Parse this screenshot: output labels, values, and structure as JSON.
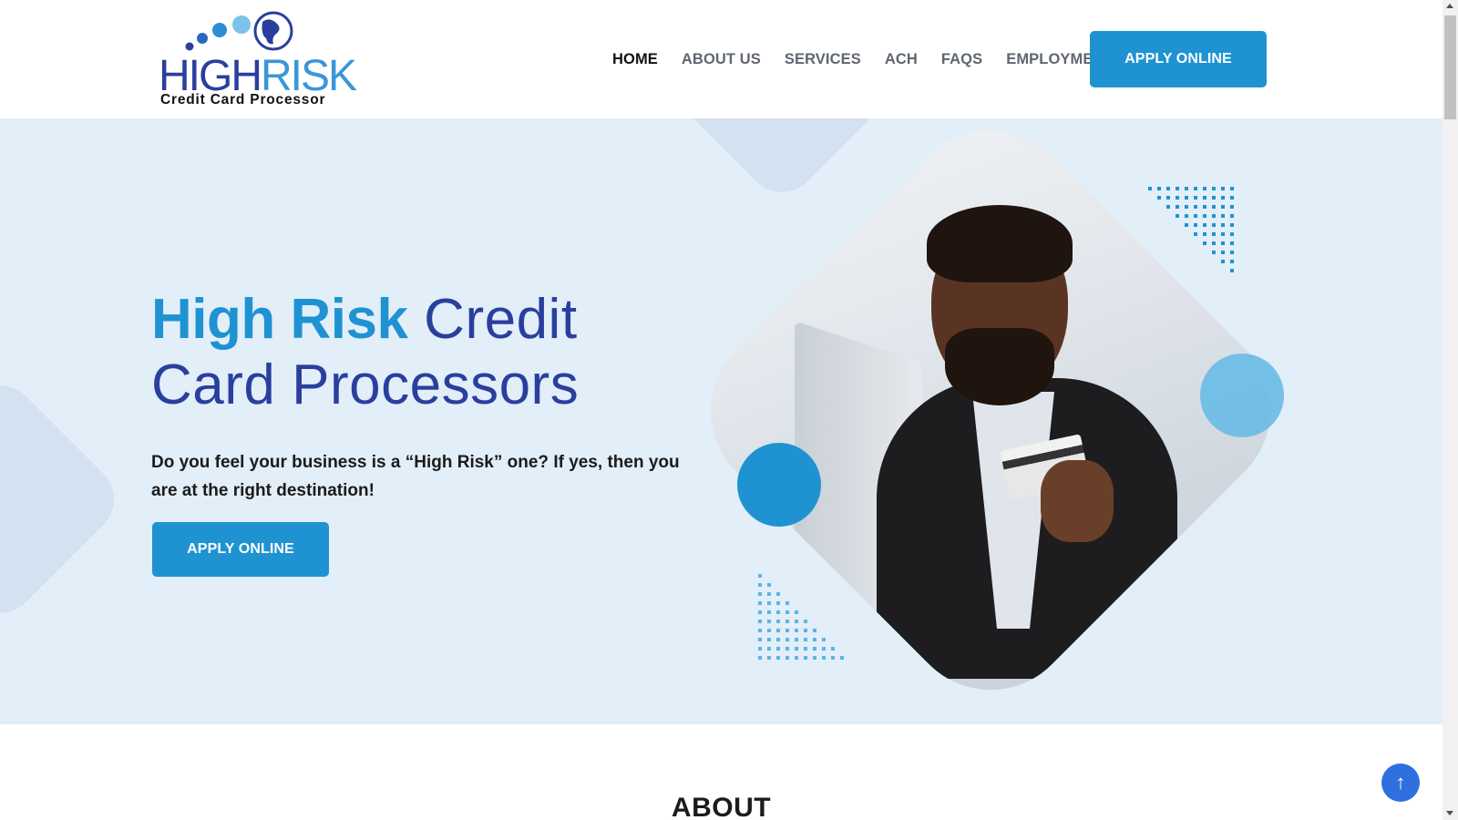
{
  "header": {
    "logo": {
      "word1": "HIGH",
      "word2": "RISK",
      "tagline": "Credit Card Processor"
    },
    "nav": [
      {
        "label": "HOME",
        "active": true
      },
      {
        "label": "ABOUT US",
        "active": false
      },
      {
        "label": "SERVICES",
        "active": false
      },
      {
        "label": "ACH",
        "active": false
      },
      {
        "label": "FAQS",
        "active": false
      },
      {
        "label": "EMPLOYMENT",
        "active": false
      }
    ],
    "cta_label": "APPLY ONLINE"
  },
  "hero": {
    "title_highlight": "High Risk",
    "title_rest": "Credit Card Processors",
    "subtitle": "Do you feel your business is a “High Risk” one? If yes, then you are at the right destination!",
    "cta_label": "APPLY ONLINE"
  },
  "about": {
    "title": "ABOUT"
  },
  "scroll_top": {
    "icon": "arrow-up-icon",
    "glyph": "↑"
  },
  "colors": {
    "primary": "#1f93d1",
    "navy": "#2a3f9d",
    "hero_bg": "#e2eef8",
    "deco": "#d3e1f1",
    "scroll_top": "#2f6fe0"
  }
}
